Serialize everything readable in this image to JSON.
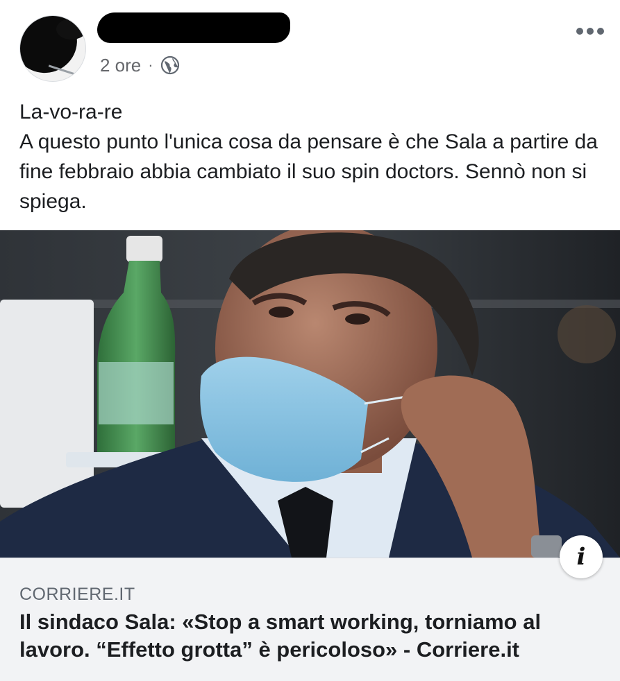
{
  "post": {
    "author_name": "",
    "time": "2 ore",
    "separator": "·",
    "privacy_icon": "globe-icon",
    "menu_icon": "more-options-icon",
    "text_lines": [
      "La-vo-ra-re",
      "A questo punto l'unica cosa da pensare è che Sala a partire da fine febbraio abbia cambiato il suo spin doctors. Sennò non si spiega."
    ]
  },
  "link_preview": {
    "domain": "CORRIERE.IT",
    "headline": "Il sindaco Sala: «Stop a smart working, torniamo al lavoro. “Effetto grotta” è pericoloso» - Corriere.it",
    "info_label": "i"
  },
  "colors": {
    "text": "#1c1e21",
    "secondary_text": "#65676b",
    "link_box_bg": "#f2f3f5"
  }
}
